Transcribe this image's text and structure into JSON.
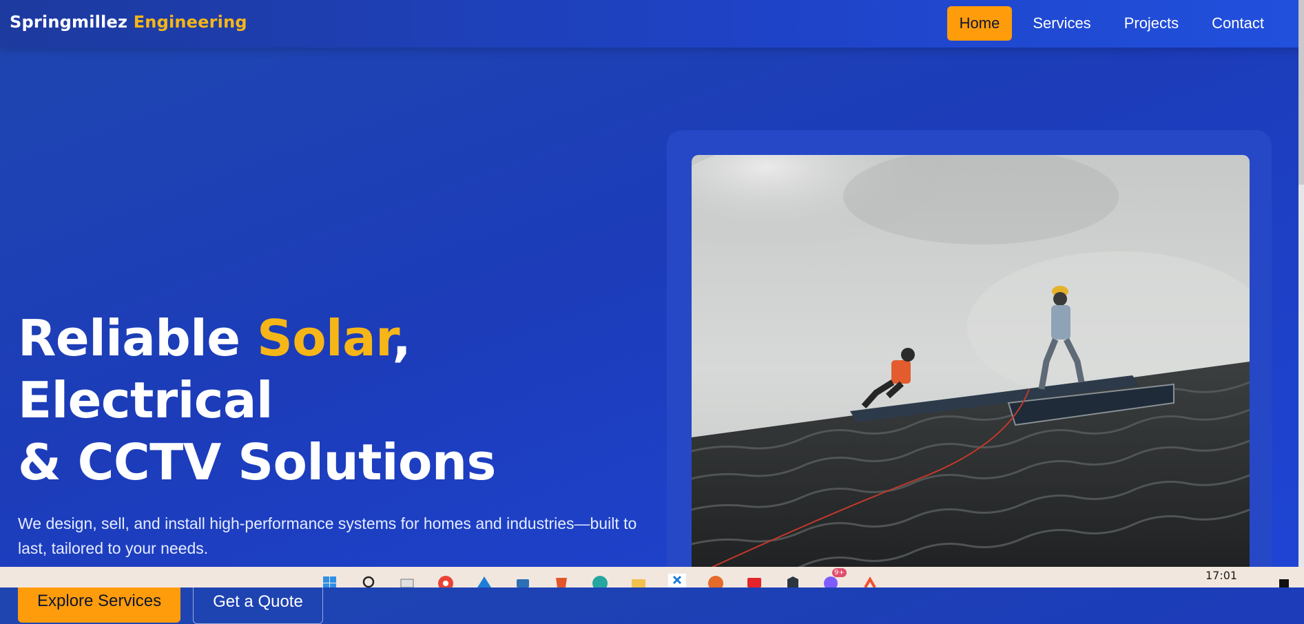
{
  "brand": {
    "name": "Springmillez",
    "accent": "Engineering"
  },
  "nav": {
    "items": [
      {
        "label": "Home",
        "active": true
      },
      {
        "label": "Services",
        "active": false
      },
      {
        "label": "Projects",
        "active": false
      },
      {
        "label": "Contact",
        "active": false
      }
    ]
  },
  "hero": {
    "title_part1": "Reliable ",
    "title_accent": "Solar",
    "title_part2": ", Electrical",
    "title_line2": "& CCTV Solutions",
    "subtitle": "We design, sell, and install high-performance systems for homes and industries—built to last, tailored to your needs.",
    "primary_button": "Explore Services",
    "secondary_button": "Get a Quote"
  },
  "taskbar": {
    "time": "17:01",
    "badge": "9+",
    "icons": [
      "windows-start-icon",
      "search-icon",
      "task-view-icon",
      "chrome-icon",
      "vscode-blue-icon",
      "store-icon",
      "brave-icon",
      "edge-icon",
      "file-explorer-icon",
      "vscode-icon",
      "firefox-icon",
      "news-icon",
      "vpn-shield-icon",
      "messenger-icon",
      "git-icon"
    ]
  },
  "colors": {
    "accent": "#f7b617",
    "button": "#ff9c0b",
    "background": "#1f43c8"
  }
}
